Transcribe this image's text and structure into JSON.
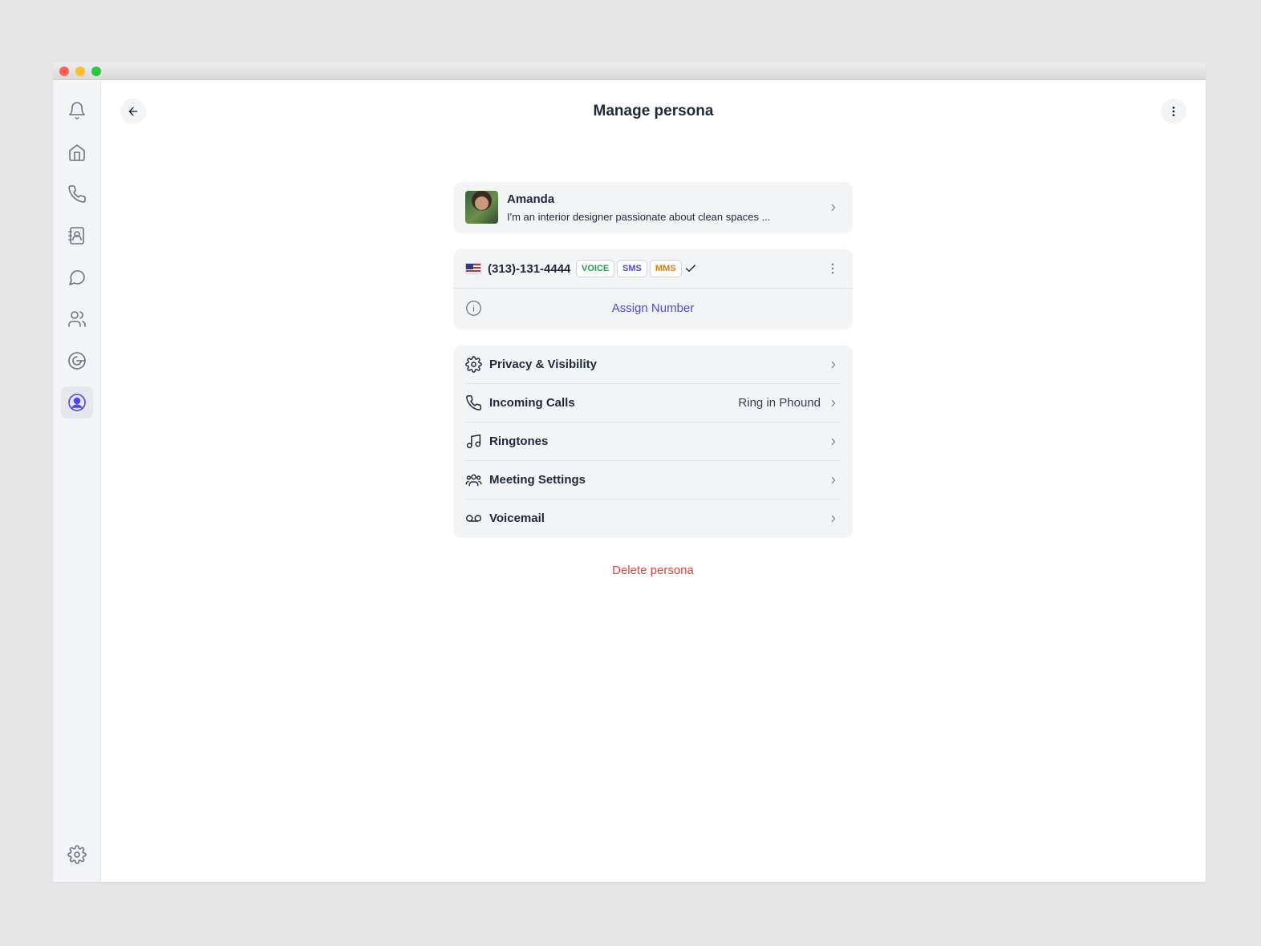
{
  "header": {
    "title": "Manage persona"
  },
  "sidebar": {
    "items": [
      {
        "icon": "bell-icon",
        "name": "notifications"
      },
      {
        "icon": "home-icon",
        "name": "home"
      },
      {
        "icon": "phone-icon",
        "name": "calls"
      },
      {
        "icon": "contacts-icon",
        "name": "contacts"
      },
      {
        "icon": "chat-icon",
        "name": "messages"
      },
      {
        "icon": "users-icon",
        "name": "team"
      },
      {
        "icon": "integration-icon",
        "name": "integrations"
      },
      {
        "icon": "user-circle-icon",
        "name": "personas",
        "active": true
      }
    ],
    "bottom": {
      "icon": "gear-icon",
      "name": "settings"
    }
  },
  "profile": {
    "name": "Amanda",
    "bio": "I'm an interior designer passionate about clean spaces ..."
  },
  "number": {
    "country_flag": "us-flag",
    "phone": "(313)-131-4444",
    "tags": [
      "VOICE",
      "SMS",
      "MMS"
    ],
    "assign_label": "Assign Number"
  },
  "settings": {
    "rows": [
      {
        "label": "Privacy & Visibility",
        "icon": "gear-icon",
        "value": ""
      },
      {
        "label": "Incoming Calls",
        "icon": "phone-icon",
        "value": "Ring in Phound"
      },
      {
        "label": "Ringtones",
        "icon": "music-note-icon",
        "value": ""
      },
      {
        "label": "Meeting Settings",
        "icon": "users-icon",
        "value": ""
      },
      {
        "label": "Voicemail",
        "icon": "voicemail-icon",
        "value": ""
      }
    ]
  },
  "actions": {
    "delete_label": "Delete persona"
  },
  "colors": {
    "accent": "#4f46e5",
    "danger": "#e53e3e",
    "voice": "#16a34a",
    "sms": "#4f46e5",
    "mms": "#d97706"
  }
}
